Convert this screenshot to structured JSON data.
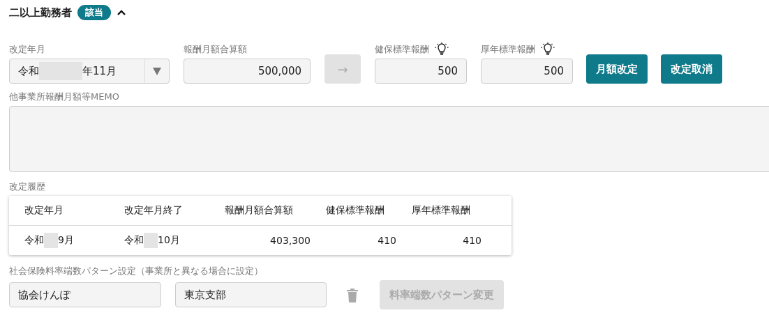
{
  "section": {
    "title": "二以上勤務者",
    "badge": "該当",
    "expanded": true
  },
  "revision": {
    "date": {
      "label": "改定年月",
      "prefix": "令和",
      "suffix": "年11月"
    },
    "total": {
      "label": "報酬月額合算額",
      "value": "500,000"
    },
    "arrow_button": {
      "label": "→",
      "disabled": true
    },
    "health": {
      "label": "健保標準報酬",
      "value": "500"
    },
    "pension": {
      "label": "厚年標準報酬",
      "value": "500"
    },
    "buttons": [
      {
        "label": "月額改定",
        "disabled": false
      },
      {
        "label": "改定取消",
        "disabled": false
      }
    ]
  },
  "memo": {
    "label": "他事業所報酬月額等MEMO"
  },
  "history": {
    "label": "改定履歴",
    "columns": [
      {
        "label": "改定年月"
      },
      {
        "label": "改定年月終了"
      },
      {
        "label": "報酬月額合算額"
      },
      {
        "label": "健保標準報酬"
      },
      {
        "label": "厚年標準報酬"
      }
    ],
    "rows": [
      {
        "cells": [
          {
            "prefix": "令和",
            "suffix": "9月"
          },
          {
            "prefix": "令和",
            "suffix": "10月"
          },
          {
            "text": "403,300"
          },
          {
            "text": "410"
          },
          {
            "text": "410"
          }
        ]
      }
    ]
  },
  "rate_pattern": {
    "label": "社会保険料率端数パターン設定（事業所と異なる場合に設定）",
    "association": "協会けんぽ",
    "branch": "東京支部",
    "change_button": {
      "label": "料率端数パターン変更",
      "disabled": true
    }
  }
}
